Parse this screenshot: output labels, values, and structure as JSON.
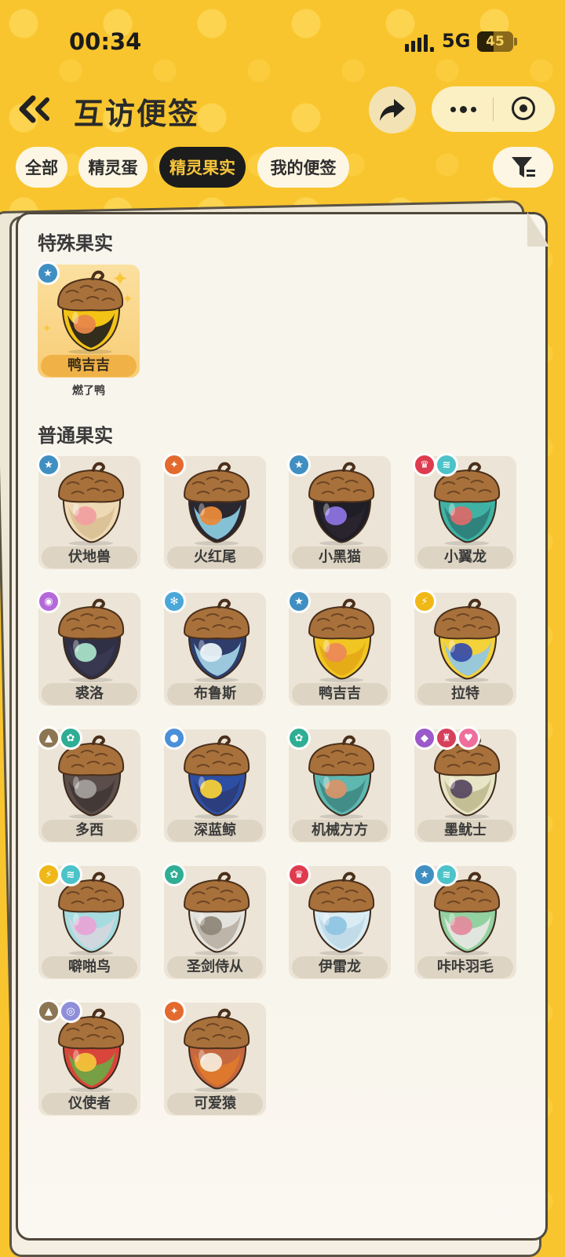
{
  "status": {
    "time": "00:34",
    "network": "5G",
    "battery": "45",
    "battery_level": 0.45
  },
  "header": {
    "title": "互访便签",
    "back_icon": "double-chevron-left-icon",
    "share_icon": "share-arrow-icon"
  },
  "tabs": [
    {
      "label": "全部",
      "active": false
    },
    {
      "label": "精灵蛋",
      "active": false
    },
    {
      "label": "精灵果实",
      "active": true
    },
    {
      "label": "我的便签",
      "active": false
    }
  ],
  "filter_icon": "filter-icon",
  "colors": {
    "background": "#f9c52e",
    "active_tab": "#1c1c1c",
    "active_tab_text": "#f8c63a",
    "special_card": "#f8cd75"
  },
  "special_section": {
    "title": "特殊果实",
    "items": [
      {
        "name": "鸭吉吉",
        "subtitle": "燃了鸭",
        "badges": [
          "normal"
        ],
        "fruit": [
          "#f3c316",
          "#e8884a",
          "#1d1d1d"
        ]
      }
    ]
  },
  "normal_section": {
    "title": "普通果实",
    "items": [
      {
        "name": "伏地兽",
        "badges": [
          "normal"
        ],
        "fruit": [
          "#eed9b5",
          "#f0a0a0",
          "#d9c093"
        ]
      },
      {
        "name": "火红尾",
        "badges": [
          "fire"
        ],
        "fruit": [
          "#2a2730",
          "#e88a3a",
          "#8fd3e8"
        ]
      },
      {
        "name": "小黑猫",
        "badges": [
          "normal"
        ],
        "fruit": [
          "#1f1d26",
          "#8c73e0",
          "#2a2630"
        ]
      },
      {
        "name": "小翼龙",
        "badges": [
          "dragon",
          "wing"
        ],
        "fruit": [
          "#3fb2a4",
          "#d96b6b",
          "#2e7d78"
        ]
      },
      {
        "name": "裘洛",
        "badges": [
          "magic"
        ],
        "fruit": [
          "#2f3045",
          "#a8e0c8",
          "#3a3b52"
        ]
      },
      {
        "name": "布鲁斯",
        "badges": [
          "ice"
        ],
        "fruit": [
          "#2e3d6b",
          "#e9f2f7",
          "#a9d7ea"
        ]
      },
      {
        "name": "鸭吉吉",
        "badges": [
          "normal"
        ],
        "fruit": [
          "#f2c622",
          "#ec8a57",
          "#e3a917"
        ]
      },
      {
        "name": "拉特",
        "badges": [
          "electric"
        ],
        "fruit": [
          "#f3d23a",
          "#3a4fa8",
          "#8fc7ea"
        ]
      },
      {
        "name": "多西",
        "badges": [
          "ground",
          "grass"
        ],
        "fruit": [
          "#5b4e4a",
          "#a39e9c",
          "#403836"
        ]
      },
      {
        "name": "深蓝鲸",
        "badges": [
          "water"
        ],
        "fruit": [
          "#2d4fa3",
          "#f4cf38",
          "#2c3c7a"
        ]
      },
      {
        "name": "机械方方",
        "badges": [
          "grass"
        ],
        "fruit": [
          "#5fb7b1",
          "#d6956a",
          "#3f8883"
        ]
      },
      {
        "name": "墨鱿士",
        "badges": [
          "ghost",
          "demon",
          "cute"
        ],
        "fruit": [
          "#e8e4c6",
          "#5a4a63",
          "#c0b98e"
        ]
      },
      {
        "name": "噼啪鸟",
        "badges": [
          "electric",
          "wing"
        ],
        "fruit": [
          "#a6dce0",
          "#e7a4d6",
          "#d5d6df"
        ]
      },
      {
        "name": "圣剑侍从",
        "badges": [
          "grass"
        ],
        "fruit": [
          "#e4e2dc",
          "#8f8879",
          "#b8b0a3"
        ]
      },
      {
        "name": "伊雷龙",
        "badges": [
          "dragon"
        ],
        "fruit": [
          "#d9ecf4",
          "#8fc5e3",
          "#bfd9e7"
        ]
      },
      {
        "name": "咔咔羽毛",
        "badges": [
          "normal",
          "wing"
        ],
        "fruit": [
          "#93d2a0",
          "#e38c9e",
          "#e9e8e4"
        ]
      },
      {
        "name": "仪使者",
        "badges": [
          "ground",
          "spiral"
        ],
        "fruit": [
          "#d9453a",
          "#f4c23a",
          "#6ca845"
        ]
      },
      {
        "name": "可爱猿",
        "badges": [
          "fire"
        ],
        "fruit": [
          "#c4683f",
          "#f5e9d8",
          "#e07a2a"
        ]
      }
    ]
  },
  "badge_types": {
    "normal": {
      "icon": "star-icon",
      "color": "#3f8fc2",
      "glyph": "★"
    },
    "fire": {
      "icon": "flame-icon",
      "color": "#e36a2e",
      "glyph": "✦"
    },
    "dragon": {
      "icon": "dragon-icon",
      "color": "#df3b4f",
      "glyph": "♛"
    },
    "wing": {
      "icon": "wing-icon",
      "color": "#4cc3c8",
      "glyph": "≋"
    },
    "magic": {
      "icon": "magic-icon",
      "color": "#b468d9",
      "glyph": "◉"
    },
    "ice": {
      "icon": "snowflake-icon",
      "color": "#4aa7d8",
      "glyph": "✻"
    },
    "electric": {
      "icon": "lightning-icon",
      "color": "#f0b817",
      "glyph": "⚡"
    },
    "ground": {
      "icon": "mountain-icon",
      "color": "#8b7553",
      "glyph": "▲"
    },
    "grass": {
      "icon": "gear-leaf-icon",
      "color": "#2fae94",
      "glyph": "✿"
    },
    "water": {
      "icon": "droplet-icon",
      "color": "#4a90d9",
      "glyph": "●"
    },
    "ghost": {
      "icon": "ghost-icon",
      "color": "#9b59c9",
      "glyph": "◆"
    },
    "demon": {
      "icon": "demon-icon",
      "color": "#d6405b",
      "glyph": "♜"
    },
    "cute": {
      "icon": "heart-icon",
      "color": "#ee6f9b",
      "glyph": "♥"
    },
    "spiral": {
      "icon": "spiral-icon",
      "color": "#8f8fd9",
      "glyph": "◎"
    }
  }
}
